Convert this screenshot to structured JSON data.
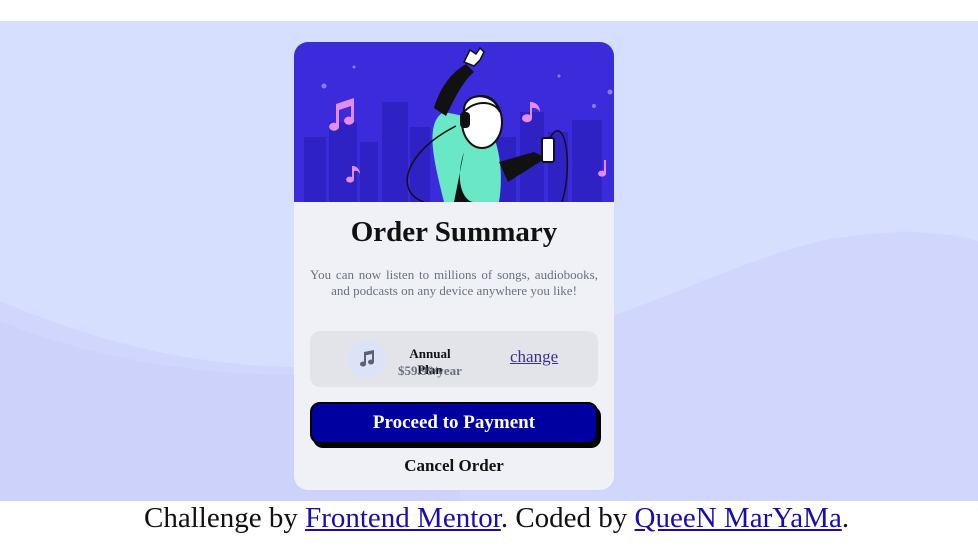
{
  "card": {
    "title": "Order Summary",
    "description": "You can now listen to millions of songs, audiobooks, and podcasts on any device anywhere you like!",
    "plan": {
      "name": "Annual Plan",
      "price": "$59.99/year",
      "change_label": "change"
    },
    "proceed_label": "Proceed to Payment",
    "cancel_label": "Cancel Order"
  },
  "footer": {
    "prefix": "Challenge by ",
    "link1": "Frontend Mentor",
    "middle": ". Coded by ",
    "link2": "QueeN MarYaMa",
    "suffix": "."
  },
  "colors": {
    "background": "#d6e0fe",
    "hero": "#3b2bdb",
    "button": "#0000a0",
    "card": "#f0f1f6"
  }
}
